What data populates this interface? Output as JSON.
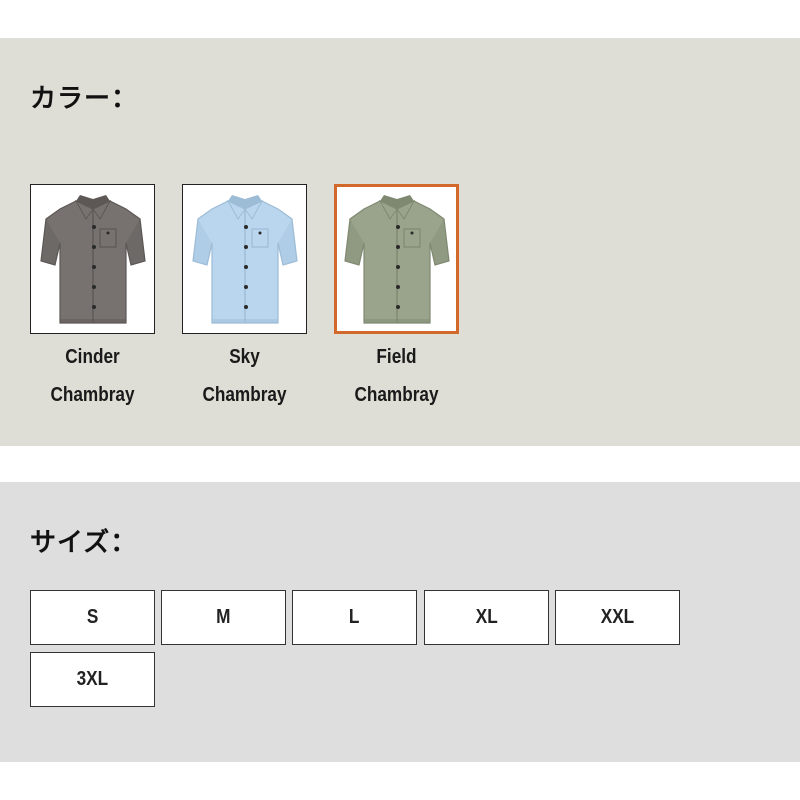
{
  "color_section": {
    "title": "カラー：",
    "swatches": [
      {
        "name_line1": "Cinder",
        "name_line2": "Chambray",
        "color": "#77726f",
        "shadow": "#5d5855",
        "selected": false
      },
      {
        "name_line1": "Sky",
        "name_line2": "Chambray",
        "color": "#b9d6ee",
        "shadow": "#9dbcd6",
        "selected": false
      },
      {
        "name_line1": "Field",
        "name_line2": "Chambray",
        "color": "#9aa48c",
        "shadow": "#7f8972",
        "selected": true
      }
    ],
    "selected_border_color": "#d2692a"
  },
  "size_section": {
    "title": "サイズ：",
    "sizes": [
      "S",
      "M",
      "L",
      "XL",
      "XXL",
      "3XL"
    ]
  }
}
